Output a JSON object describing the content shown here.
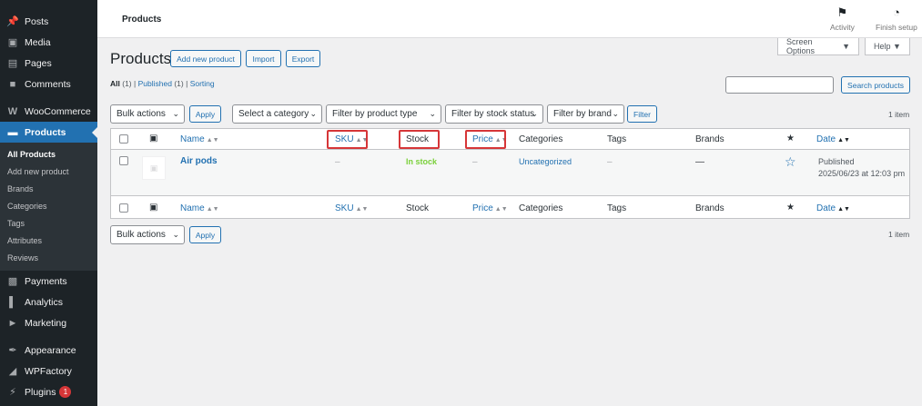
{
  "sidebar": {
    "items": [
      {
        "label": "Posts",
        "icon": "pin-icon"
      },
      {
        "label": "Media",
        "icon": "media-icon"
      },
      {
        "label": "Pages",
        "icon": "pages-icon"
      },
      {
        "label": "Comments",
        "icon": "comments-icon"
      },
      {
        "label": "WooCommerce",
        "icon": "woocommerce-icon"
      },
      {
        "label": "Products",
        "icon": "products-icon"
      },
      {
        "label": "Payments",
        "icon": "payments-icon"
      },
      {
        "label": "Analytics",
        "icon": "analytics-icon"
      },
      {
        "label": "Marketing",
        "icon": "marketing-icon"
      },
      {
        "label": "Appearance",
        "icon": "appearance-icon"
      },
      {
        "label": "WPFactory",
        "icon": "wpfactory-icon"
      },
      {
        "label": "Plugins",
        "icon": "plugins-icon",
        "badge": "1"
      }
    ],
    "submenu": [
      "All Products",
      "Add new product",
      "Brands",
      "Categories",
      "Tags",
      "Attributes",
      "Reviews"
    ]
  },
  "header": {
    "title": "Products",
    "activity": "Activity",
    "finish_setup": "Finish setup"
  },
  "screen_options": "Screen Options",
  "help": "Help",
  "page": {
    "title": "Products",
    "add_new": "Add new product",
    "import": "Import",
    "export": "Export"
  },
  "views": {
    "all": "All",
    "all_count": "(1)",
    "published": "Published",
    "published_count": "(1)",
    "sorting": "Sorting",
    "sep": "|"
  },
  "search": {
    "value": "",
    "button": "Search products"
  },
  "filters": {
    "bulk_actions": "Bulk actions",
    "apply": "Apply",
    "category": "Select a category",
    "product_type": "Filter by product type",
    "stock_status": "Filter by stock status",
    "brand": "Filter by brand",
    "filter": "Filter",
    "items_count": "1 item"
  },
  "table": {
    "columns": {
      "name": "Name",
      "sku": "SKU",
      "stock": "Stock",
      "price": "Price",
      "categories": "Categories",
      "tags": "Tags",
      "brands": "Brands",
      "date": "Date"
    },
    "rows": [
      {
        "name": "Air pods",
        "sku": "–",
        "stock": "In stock",
        "price": "–",
        "categories": "Uncategorized",
        "tags": "–",
        "brands": "—",
        "date_status": "Published",
        "date": "2025/06/23 at 12:03 pm"
      }
    ]
  },
  "colors": {
    "sidebar_bg": "#1d2327",
    "accent": "#2271b1",
    "in_stock": "#7ad03a",
    "highlight": "#d63638"
  }
}
